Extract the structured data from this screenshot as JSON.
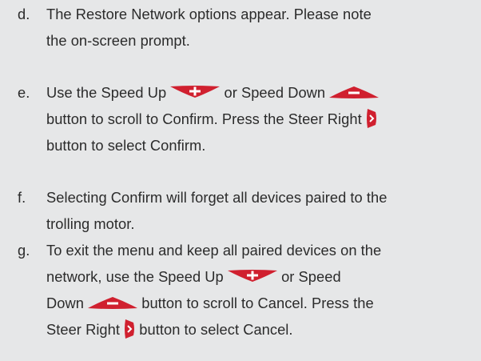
{
  "steps": [
    {
      "marker": "d.",
      "lines": [
        "The Restore Network options appear. Please note",
        "the on-screen prompt."
      ]
    },
    {
      "marker": "e.",
      "line1_a": "Use the Speed Up",
      "line1_b": "or Speed Down",
      "line2_a": "button to scroll to Confirm. Press the Steer Right",
      "line3": "button to select Confirm."
    },
    {
      "marker": "f.",
      "lines": [
        "Selecting Confirm will forget all devices paired to the",
        "trolling motor."
      ]
    },
    {
      "marker": "g.",
      "line1": "To exit the menu and keep all paired devices on the",
      "line2_a": "network, use the Speed Up",
      "line2_b": "or Speed",
      "line3_a": "Down",
      "line3_b": "button to scroll to Cancel. Press the",
      "line4_a": "Steer Right",
      "line4_b": "button to select Cancel."
    }
  ],
  "icons": {
    "speed_up": "speed-up-button-icon",
    "speed_down": "speed-down-button-icon",
    "steer_right": "steer-right-button-icon",
    "color": "#d0202f"
  }
}
